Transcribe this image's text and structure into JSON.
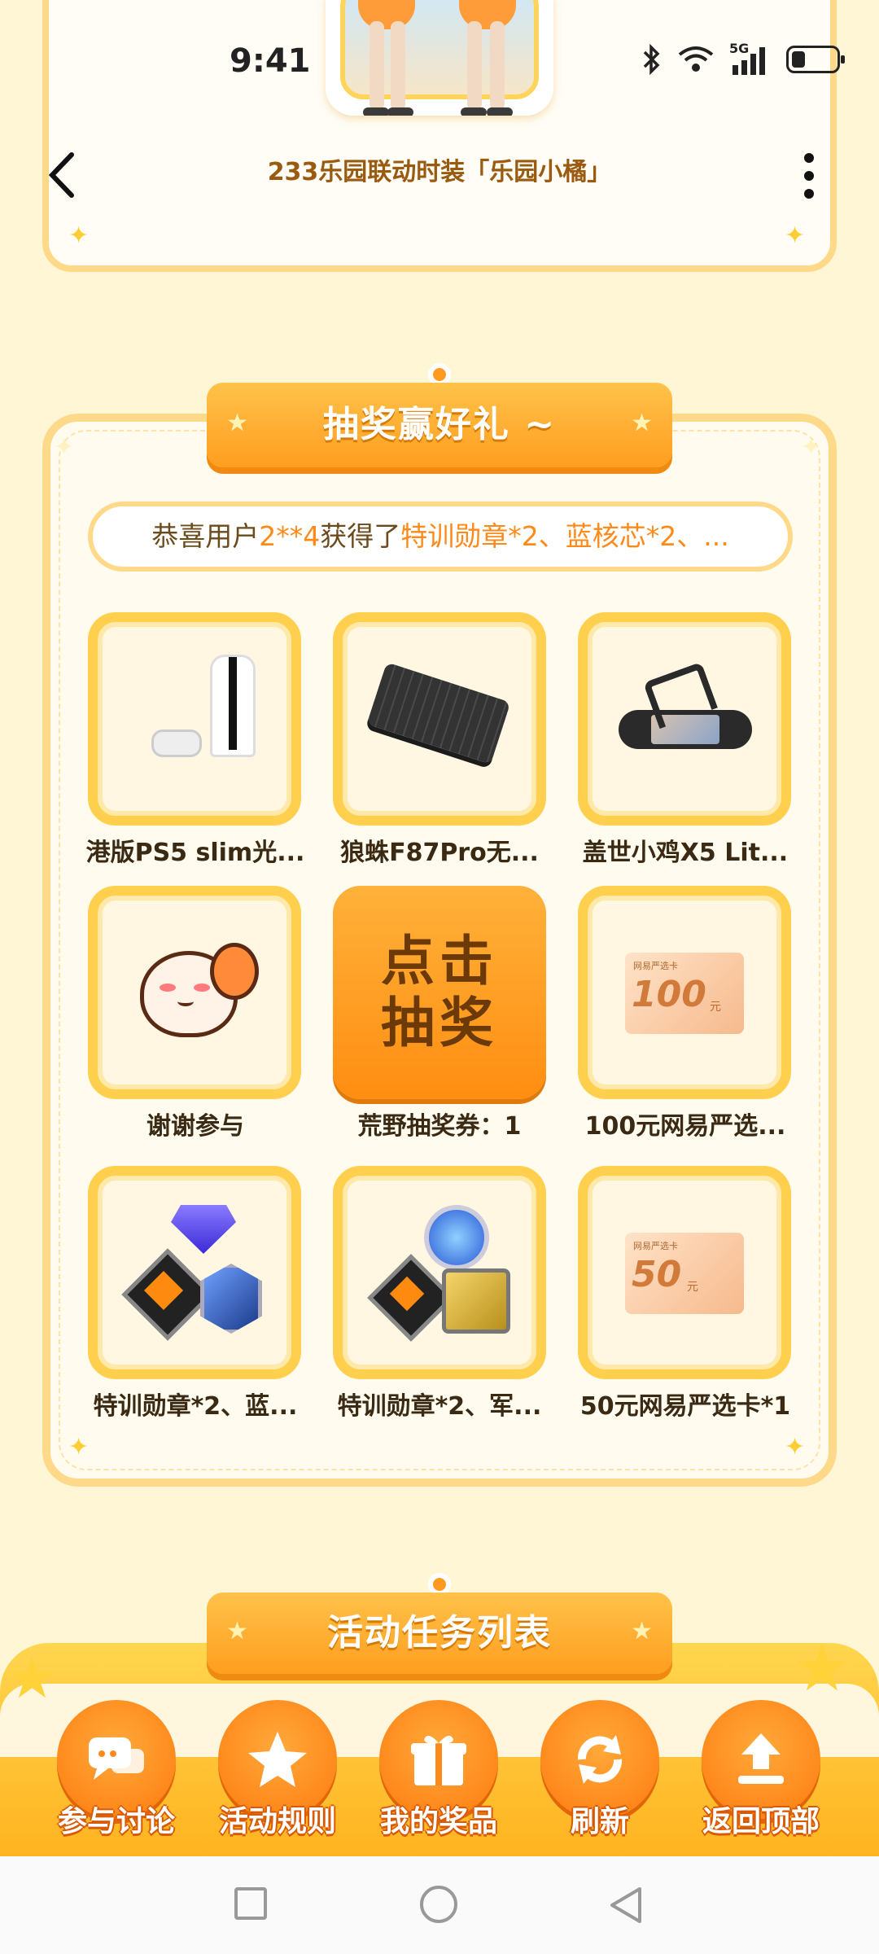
{
  "status_bar": {
    "time": "9:41",
    "network": "5G"
  },
  "top_card": {
    "caption": "233乐园联动时装「乐园小橘」"
  },
  "lottery": {
    "title": "抽奖赢好礼 ~",
    "winner_prefix": "恭喜用户",
    "winner_user": "2**4",
    "winner_mid": "获得了",
    "winner_prize": "特训勋章*2、蓝核芯*2、...",
    "prizes": [
      {
        "label": "港版PS5 slim光...",
        "icon": "ps5-console-icon"
      },
      {
        "label": "狼蛛F87Pro无...",
        "icon": "keyboard-icon"
      },
      {
        "label": "盖世小鸡X5 Lit...",
        "icon": "gamepad-controller-icon"
      },
      {
        "label": "谢谢参与",
        "icon": "mascot-thanks-icon"
      },
      {
        "label": "荒野抽奖券：1",
        "draw_text_1": "点击",
        "draw_text_2": "抽奖"
      },
      {
        "label": "100元网易严选...",
        "voucher_value": "100",
        "voucher_unit": "元",
        "voucher_brand": "网易严选卡"
      },
      {
        "label": "特训勋章*2、蓝...",
        "icon": "gems-badges-icon"
      },
      {
        "label": "特训勋章*2、军...",
        "icon": "medals-chip-icon"
      },
      {
        "label": "50元网易严选卡*1",
        "voucher_value": "50",
        "voucher_unit": "元",
        "voucher_brand": "网易严选卡"
      }
    ]
  },
  "tasks": {
    "title": "活动任务列表"
  },
  "bottom_nav": [
    {
      "label": "参与讨论",
      "icon": "chat-bubble-icon"
    },
    {
      "label": "活动规则",
      "icon": "rules-star-icon"
    },
    {
      "label": "我的奖品",
      "icon": "gift-icon"
    },
    {
      "label": "刷新",
      "icon": "refresh-icon"
    },
    {
      "label": "返回顶部",
      "icon": "upload-top-icon"
    }
  ],
  "colors": {
    "accent": "#ff9e1f",
    "panel_border": "#ffd98a",
    "background": "#fff6d6"
  }
}
